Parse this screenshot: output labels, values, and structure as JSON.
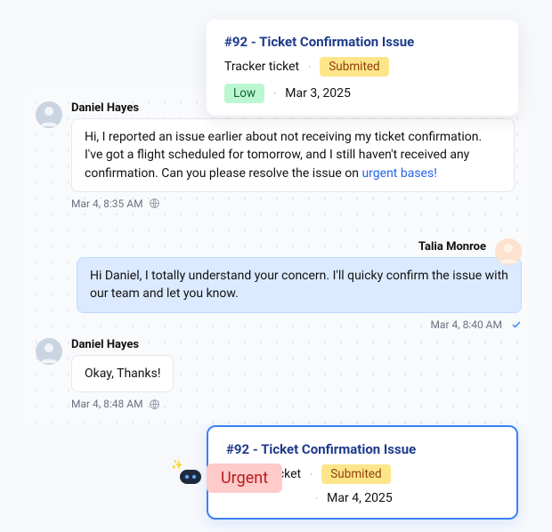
{
  "ticket_top": {
    "title": "#92 - Ticket Confirmation Issue",
    "type": "Tracker ticket",
    "status": "Submited",
    "priority": "Low",
    "date": "Mar 3, 2025"
  },
  "ticket_bottom": {
    "title": "#92 - Ticket Confirmation Issue",
    "type": "Tracker ticket",
    "status": "Submited",
    "priority": "Urgent",
    "date": "Mar 4, 2025"
  },
  "messages": {
    "m1": {
      "sender": "Daniel Hayes",
      "body_pre": "Hi, I reported an issue earlier about not receiving my ticket confirmation. I've got a flight scheduled for tomorrow, and I still haven't received any confirmation. Can you please resolve the issue on ",
      "body_link": "urgent bases!",
      "time": "Mar 4, 8:35 AM"
    },
    "m2": {
      "sender": "Talia Monroe",
      "body": "Hi Daniel, I totally understand your concern. I'll quicky confirm the issue with our team and let you know.",
      "time": "Mar 4, 8:40 AM"
    },
    "m3": {
      "sender": "Daniel Hayes",
      "body": "Okay, Thanks!",
      "time": "Mar 4, 8:48 AM"
    }
  }
}
